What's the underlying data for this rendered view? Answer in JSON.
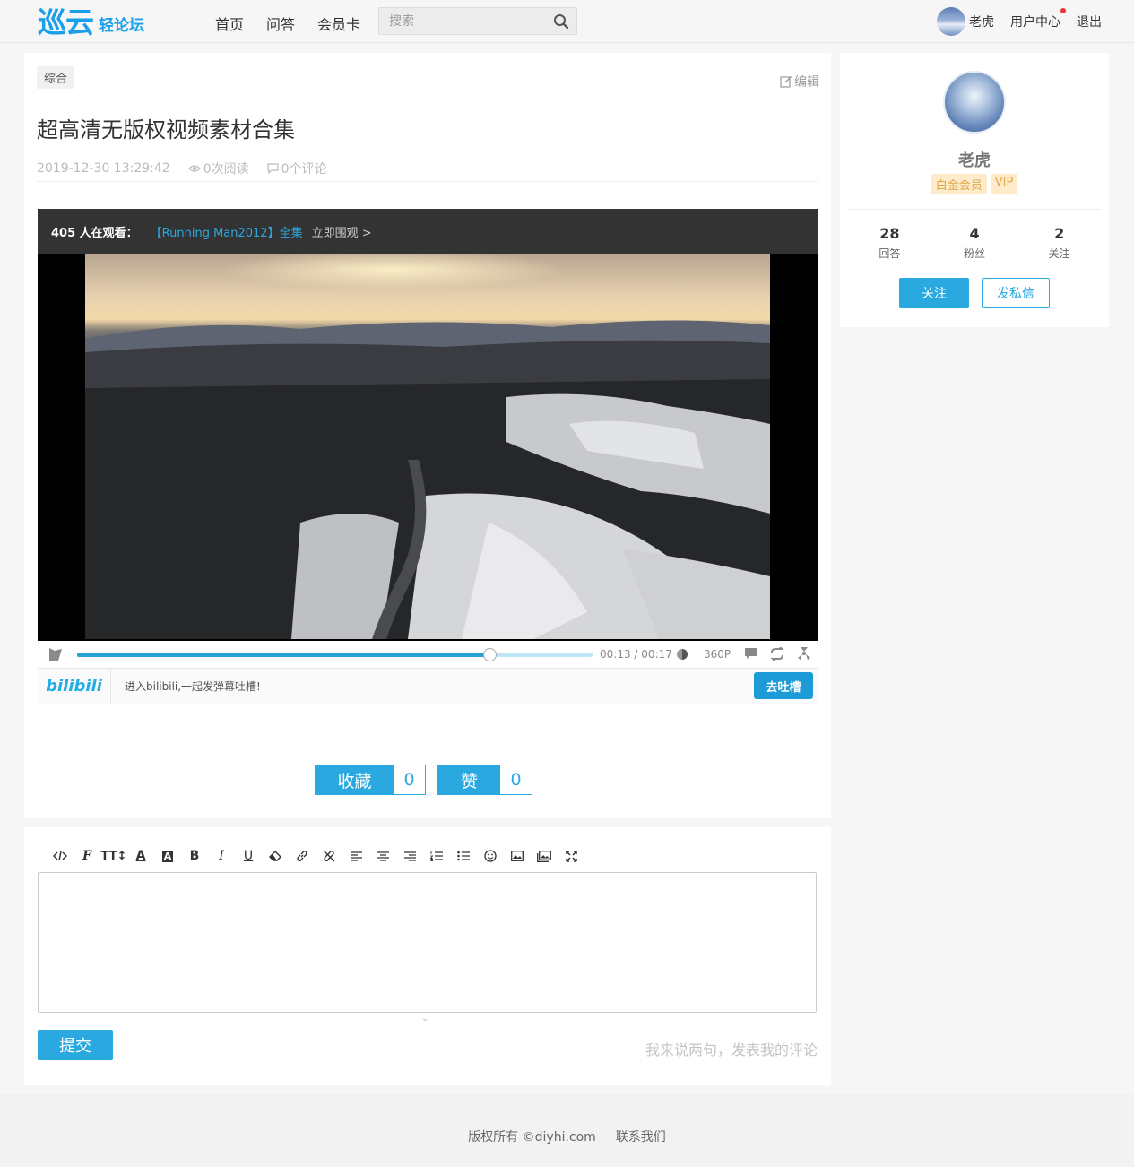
{
  "header": {
    "logo_main": "巡云",
    "logo_sub": "轻论坛",
    "nav": [
      "首页",
      "问答",
      "会员卡"
    ],
    "search_placeholder": "搜索",
    "user_name": "老虎",
    "user_center": "用户中心",
    "logout": "退出"
  },
  "post": {
    "category": "综合",
    "edit_label": "编辑",
    "title": "超高清无版权视频素材合集",
    "datetime": "2019-12-30 13:29:42",
    "views": "0次阅读",
    "comments": "0个评论"
  },
  "player": {
    "viewers": "405 人在观看：",
    "live_title": "【Running Man2012】全集",
    "watch_now": "立即围观 >",
    "progress": 0.8,
    "current_time": "00:13",
    "separator": "/",
    "total_time": "00:17",
    "quality": "360P",
    "bili_logo": "bilibili",
    "bili_text": "进入bilibili,一起发弹幕吐槽!",
    "bili_button": "去吐槽"
  },
  "actions": {
    "favorite_label": "收藏",
    "favorite_count": "0",
    "like_label": "赞",
    "like_count": "0"
  },
  "editor": {
    "toolbar": [
      "code-icon",
      "font-family-icon",
      "font-size-icon",
      "font-color-icon",
      "highlight-icon",
      "bold-icon",
      "italic-icon",
      "underline-icon",
      "eraser-icon",
      "link-icon",
      "unlink-icon",
      "align-left-icon",
      "align-center-icon",
      "align-right-icon",
      "ordered-list-icon",
      "unordered-list-icon",
      "emoticon-icon",
      "image-icon",
      "multi-image-icon",
      "fullscreen-icon"
    ],
    "submit_label": "提交",
    "hint": "我来说两句，发表我的评论"
  },
  "author": {
    "name": "老虎",
    "badges": [
      "白金会员",
      "VIP"
    ],
    "stats": [
      {
        "value": "28",
        "label": "回答"
      },
      {
        "value": "4",
        "label": "粉丝"
      },
      {
        "value": "2",
        "label": "关注"
      }
    ],
    "follow_label": "关注",
    "message_label": "发私信"
  },
  "footer": {
    "copyright": "版权所有 ©diyhi.com",
    "contact": "联系我们"
  },
  "colors": {
    "accent": "#29a9e0",
    "brand": "#1a9fea",
    "badge_bg": "#fdebc9",
    "badge_text": "#e1a94c"
  }
}
